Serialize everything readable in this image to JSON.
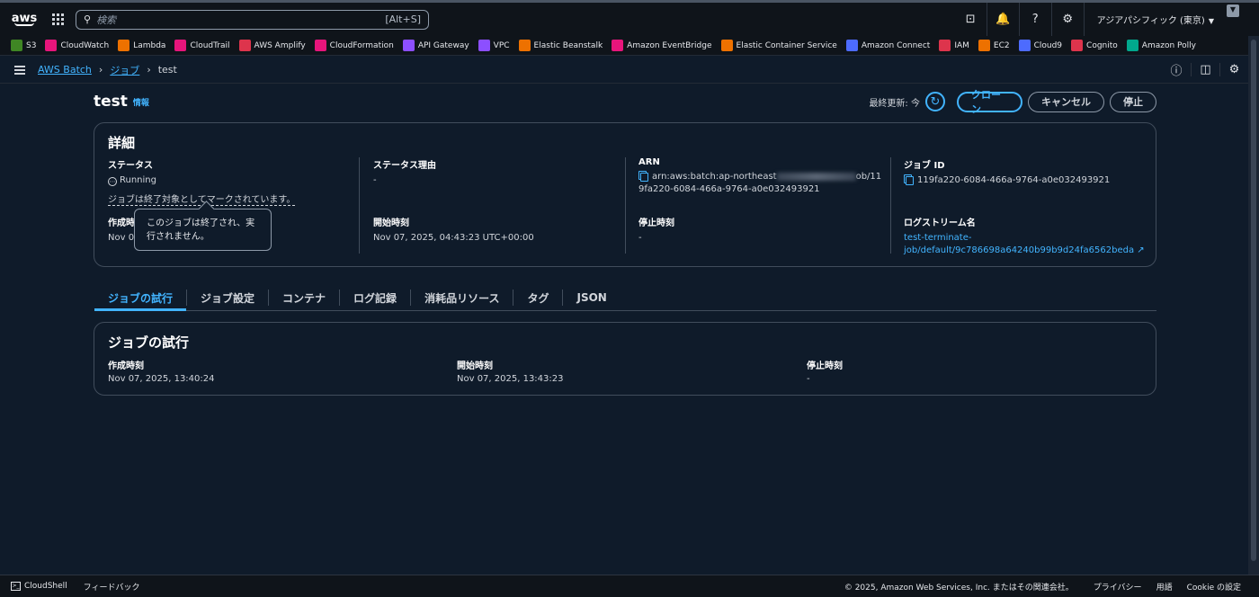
{
  "topbar": {
    "logo_text": "aws",
    "search_placeholder": "検索",
    "search_shortcut": "[Alt+S]",
    "region": "アジアパシフィック (東京)"
  },
  "favorites": [
    {
      "label": "S3",
      "color": "#3f8624"
    },
    {
      "label": "CloudWatch",
      "color": "#e7157b"
    },
    {
      "label": "Lambda",
      "color": "#ed7100"
    },
    {
      "label": "CloudTrail",
      "color": "#e7157b"
    },
    {
      "label": "AWS Amplify",
      "color": "#dd344c"
    },
    {
      "label": "CloudFormation",
      "color": "#e7157b"
    },
    {
      "label": "API Gateway",
      "color": "#8c4fff"
    },
    {
      "label": "VPC",
      "color": "#8c4fff"
    },
    {
      "label": "Elastic Beanstalk",
      "color": "#ed7100"
    },
    {
      "label": "Amazon EventBridge",
      "color": "#e7157b"
    },
    {
      "label": "Elastic Container Service",
      "color": "#ed7100"
    },
    {
      "label": "Amazon Connect",
      "color": "#4d6bfe"
    },
    {
      "label": "IAM",
      "color": "#dd344c"
    },
    {
      "label": "EC2",
      "color": "#ed7100"
    },
    {
      "label": "Cloud9",
      "color": "#4d6bfe"
    },
    {
      "label": "Cognito",
      "color": "#dd344c"
    },
    {
      "label": "Amazon Polly",
      "color": "#01a88d"
    }
  ],
  "breadcrumb": {
    "root": "AWS Batch",
    "jobs": "ジョブ",
    "current": "test"
  },
  "header": {
    "title": "test",
    "info": "情報",
    "last_updated": "最終更新: 今",
    "clone": "クローン",
    "cancel": "キャンセル",
    "stop": "停止"
  },
  "details": {
    "heading": "詳細",
    "status_label": "ステータス",
    "status_value": "Running",
    "status_note": "ジョブは終了対象としてマークされています。",
    "status_reason_label": "ステータス理由",
    "status_reason_value": "-",
    "arn_label": "ARN",
    "arn_prefix": "arn:aws:batch:ap-northeast",
    "arn_suffix": "ob/11",
    "arn_line2": "9fa220-6084-466a-9764-a0e032493921",
    "jobid_label": "ジョブ ID",
    "jobid_value": "119fa220-6084-466a-9764-a0e032493921",
    "created_label": "作成時刻",
    "created_value": "Nov 07, 2025, 13:40:24",
    "started_label": "開始時刻",
    "started_value": "Nov 07, 2025, 04:43:23 UTC+00:00",
    "stopped_label": "停止時刻",
    "stopped_value": "-",
    "logstream_label": "ログストリーム名",
    "logstream_line1": "test-terminate-",
    "logstream_line2": "job/default/9c786698a64240b99b9d24fa6562beda"
  },
  "tooltip": {
    "line1": "このジョブは終了され、実",
    "line2": "行されません。"
  },
  "tabs": [
    "ジョブの試行",
    "ジョブ設定",
    "コンテナ",
    "ログ記録",
    "消耗品リソース",
    "タグ",
    "JSON"
  ],
  "attempts": {
    "heading": "ジョブの試行",
    "created_label": "作成時刻",
    "created_value": "Nov 07, 2025, 13:40:24",
    "started_label": "開始時刻",
    "started_value": "Nov 07, 2025, 13:43:23",
    "stopped_label": "停止時刻",
    "stopped_value": "-"
  },
  "footer": {
    "cloudshell": "CloudShell",
    "feedback": "フィードバック",
    "copyright": "© 2025, Amazon Web Services, Inc. またはその関連会社。",
    "privacy": "プライバシー",
    "terms": "用語",
    "cookie": "Cookie の設定"
  }
}
